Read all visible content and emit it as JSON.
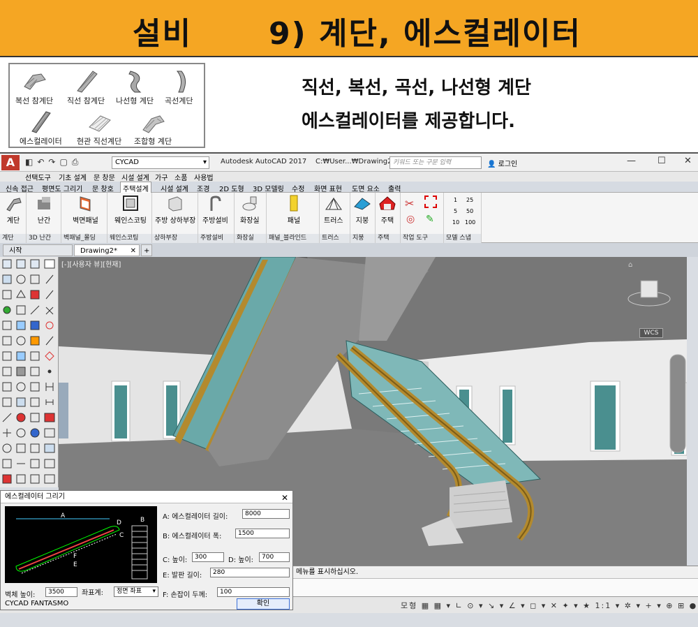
{
  "banner": {
    "title_left": "설비",
    "title_right": "9) 계단, 에스컬레이터"
  },
  "stair_types": [
    "복선 참계단",
    "직선 참계단",
    "나선형 계단",
    "곡선계단",
    "에스컬레이터",
    "현관 직선계단",
    "조합형 계단"
  ],
  "intro_lines": [
    "직선, 복선, 곡선, 나선형 계단",
    "에스컬레이터를 제공합니다."
  ],
  "window": {
    "app_logo": "A",
    "workspace": "CYCAD",
    "title": "Autodesk AutoCAD 2017",
    "file_path": "C:₩User...₩Drawing2.dwg",
    "search_placeholder": "키워드 또는 구문 입력",
    "login": "로그인"
  },
  "menubar": [
    "선택도구",
    "기초 설계",
    "문 창문",
    "시설 설계",
    "가구",
    "소품",
    "사용법"
  ],
  "ribbon_tabs": [
    "신속 접근",
    "평면도 그리기",
    "문 창호",
    "주택설계",
    "시설 설계",
    "조경",
    "2D 도형",
    "3D 모델링",
    "수정",
    "화면 표현",
    "도면 요소",
    "출력"
  ],
  "active_ribbon_tab": "주택설계",
  "ribbon_buttons": [
    "계단",
    "난간",
    "벽면패널",
    "웨인스코팅",
    "주방 상하부장",
    "주방설비",
    "화장실",
    "패널",
    "트러스",
    "지붕",
    "주택"
  ],
  "ribbon_groups": [
    "계단",
    "3D 난간",
    "벽패널_몰딩",
    "웨인스코팅",
    "상하부장",
    "주방설비",
    "화장실",
    "패널_블라인드",
    "트러스",
    "지붕",
    "주택",
    "작업 도구",
    "모델 스냅"
  ],
  "snap_values": [
    "1",
    "25",
    "5",
    "50",
    "10",
    "100"
  ],
  "doc_tabs": [
    "시작",
    "Drawing2*"
  ],
  "viewport": {
    "label": "[-][사용자 뷰][현재]",
    "wcs": "WCS"
  },
  "command_line": "메뉴를 표시하십시오.",
  "status": {
    "left": "CYCAD FANTASMO",
    "model": "모형",
    "scale": "1:1"
  },
  "dialog": {
    "title": "에스컬레이터 그리기",
    "fields": {
      "length_label": "A: 에스컬레이터 길이:",
      "length": "8000",
      "width_label": "B: 에스컬레이터 폭:",
      "width": "1500",
      "height_label": "C: 높이:",
      "height": "300",
      "d_height_label": "D: 높이:",
      "d_height": "700",
      "step_label": "E: 발판 길이:",
      "step": "280",
      "handrail_label": "F: 손잡이 두께:",
      "handrail": "100",
      "wall_height_label": "벽체 높이:",
      "wall_height": "3500",
      "coord_label": "좌표계:",
      "coord": "정면 좌표"
    },
    "ok_label": "확인",
    "preview_letters": [
      "A",
      "B",
      "C",
      "D",
      "E",
      "F"
    ]
  }
}
